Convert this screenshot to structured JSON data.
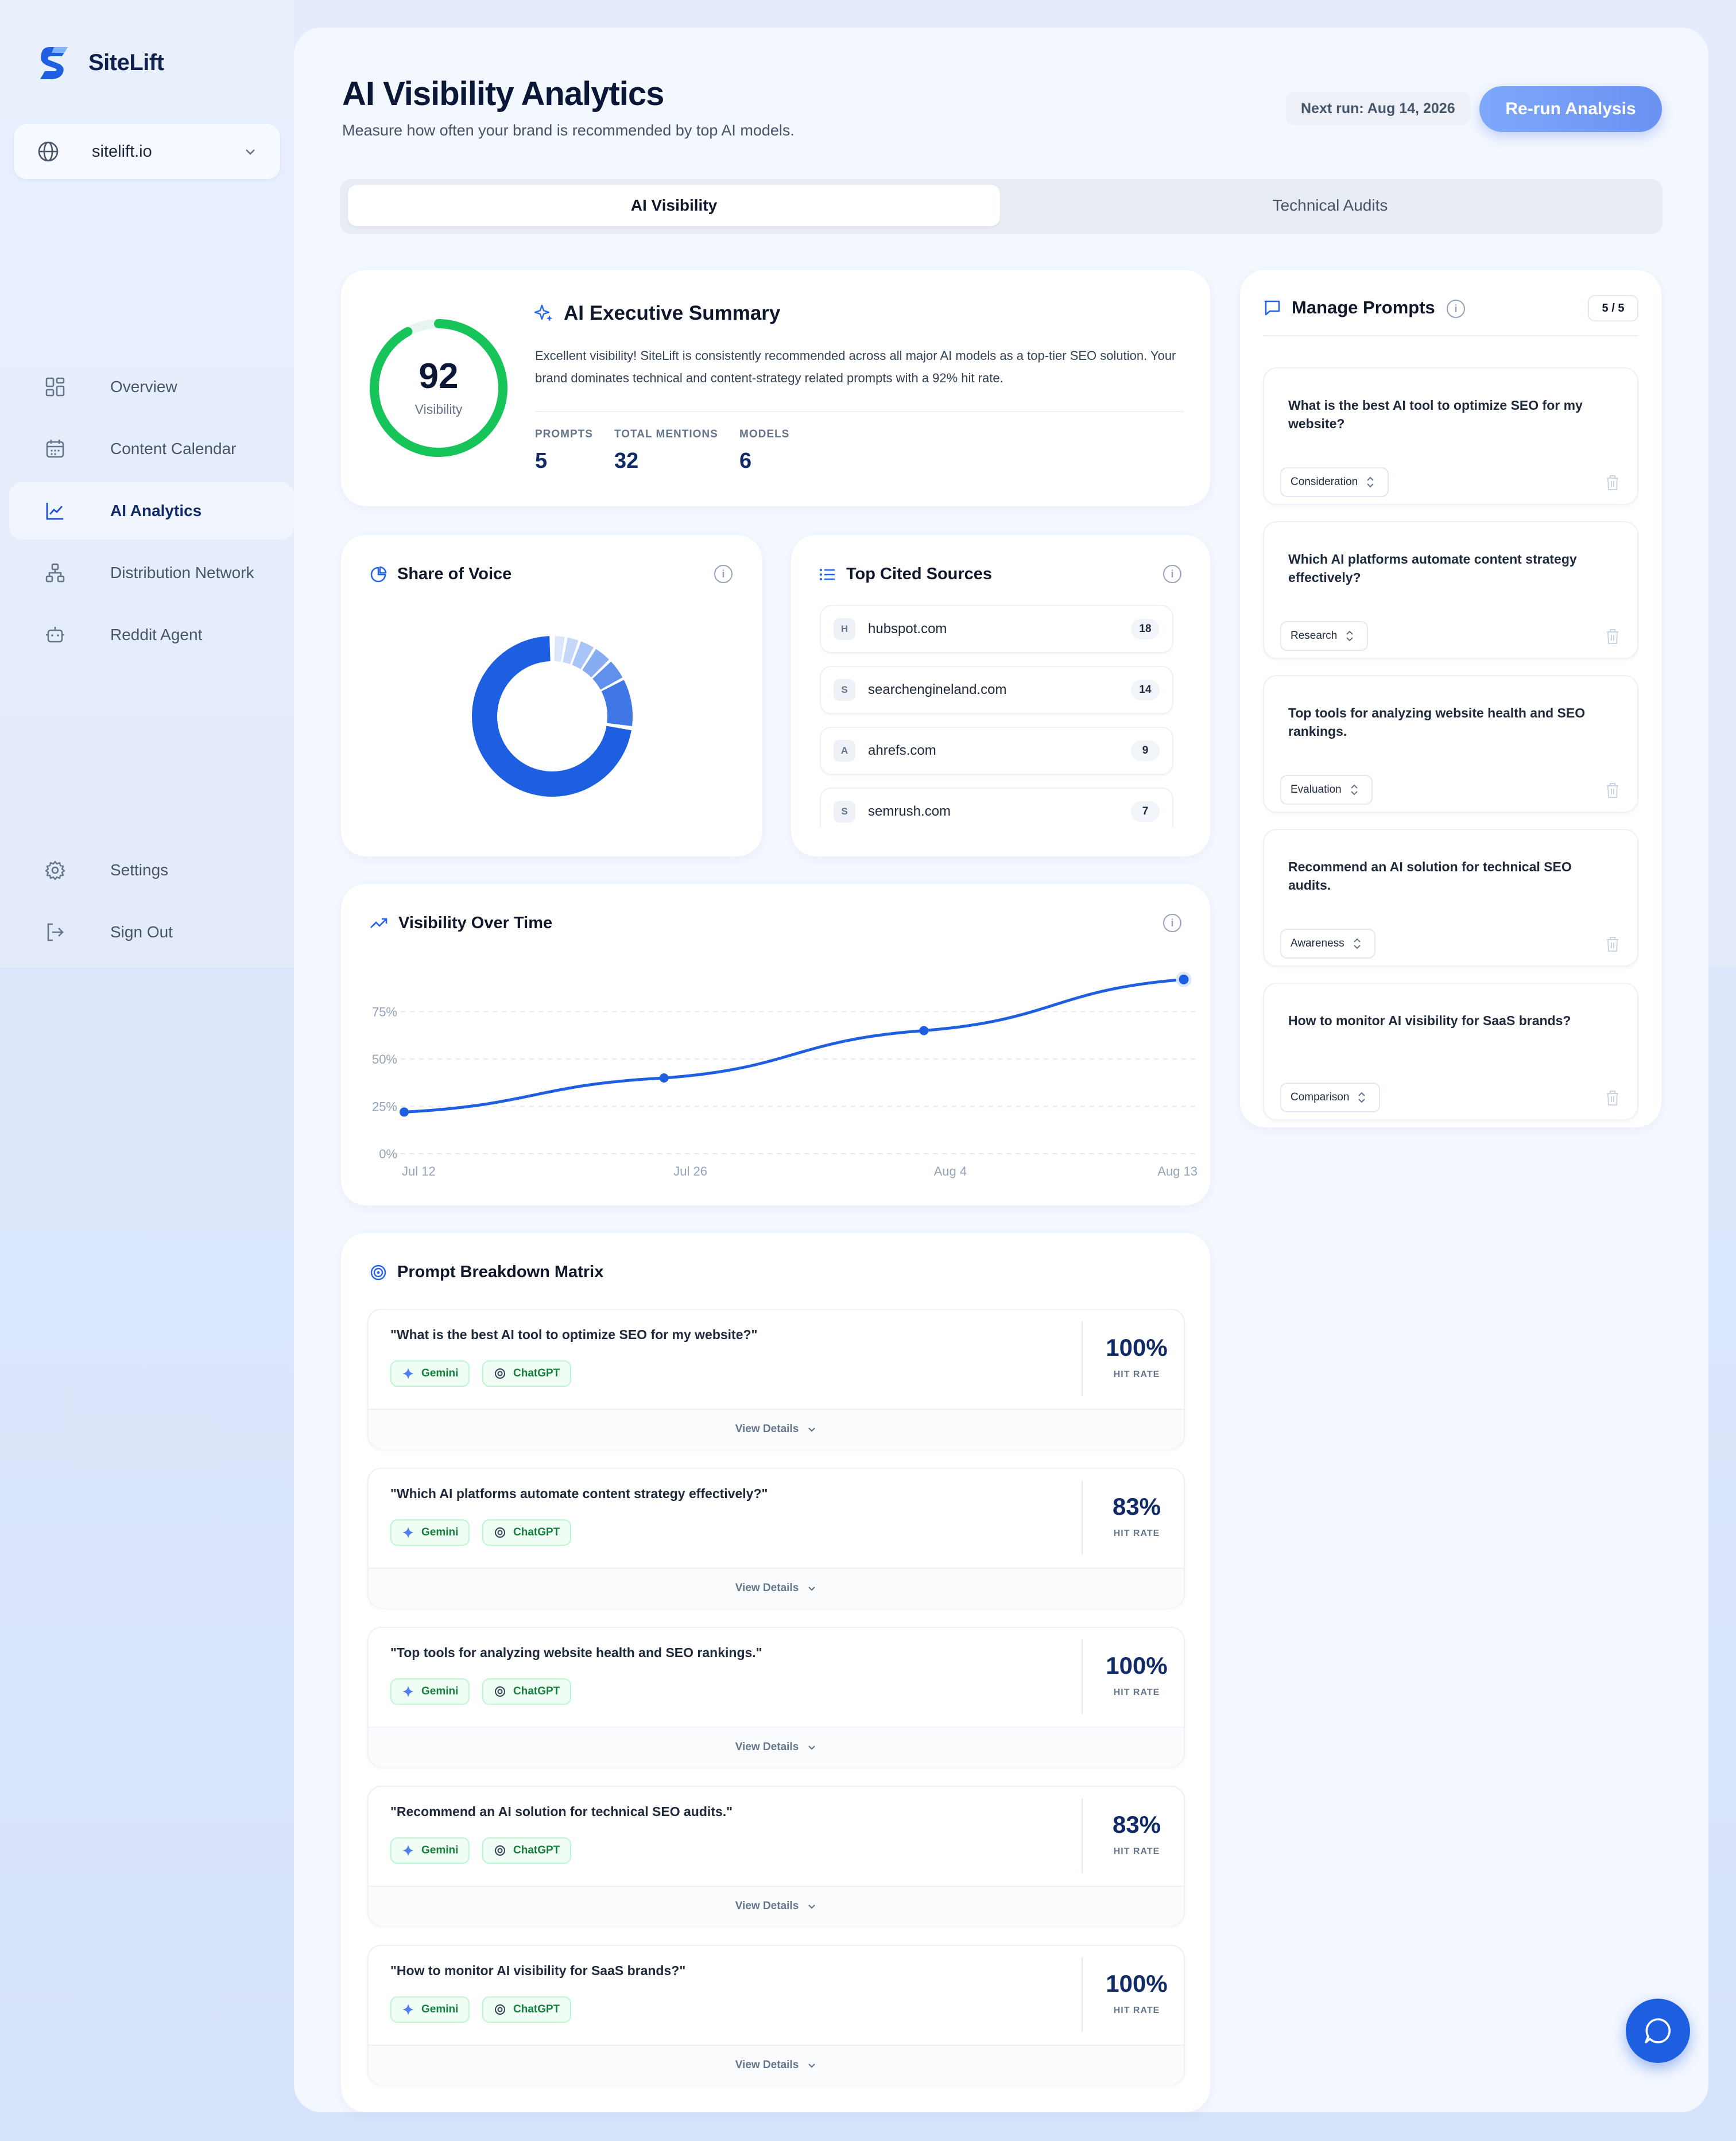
{
  "app": {
    "name": "SiteLift"
  },
  "site_selector": {
    "value": "sitelift.io"
  },
  "nav": {
    "overview": "Overview",
    "content_calendar": "Content Calendar",
    "ai_analytics": "AI Analytics",
    "distribution_network": "Distribution Network",
    "reddit_agent": "Reddit Agent",
    "settings": "Settings",
    "sign_out": "Sign Out"
  },
  "header": {
    "title": "AI Visibility Analytics",
    "subtitle": "Measure how often your brand is recommended by top AI models.",
    "next_run": "Next run: Aug 14, 2026",
    "rerun_label": "Re-run Analysis"
  },
  "tabs": {
    "ai_visibility": "AI Visibility",
    "technical_audits": "Technical Audits"
  },
  "summary": {
    "score": "92",
    "score_label": "Visibility",
    "score_fraction": 0.92,
    "title": "AI Executive Summary",
    "text": "Excellent visibility! SiteLift is consistently recommended across all major AI models as a top-tier SEO solution. Your brand dominates technical and content-strategy related prompts with a 92% hit rate.",
    "stats": [
      {
        "label": "PROMPTS",
        "value": "5"
      },
      {
        "label": "TOTAL MENTIONS",
        "value": "32"
      },
      {
        "label": "MODELS",
        "value": "6"
      }
    ]
  },
  "share_of_voice": {
    "title": "Share of Voice"
  },
  "top_sources": {
    "title": "Top Cited Sources",
    "items": [
      {
        "letter": "H",
        "domain": "hubspot.com",
        "count": "18"
      },
      {
        "letter": "S",
        "domain": "searchengineland.com",
        "count": "14"
      },
      {
        "letter": "A",
        "domain": "ahrefs.com",
        "count": "9"
      },
      {
        "letter": "S",
        "domain": "semrush.com",
        "count": "7"
      }
    ]
  },
  "chart_data": {
    "type": "line",
    "title": "Visibility Over Time",
    "x": [
      "Jul 12",
      "Jul 26",
      "Aug 4",
      "Aug 13"
    ],
    "y_ticks": [
      "0%",
      "25%",
      "50%",
      "75%"
    ],
    "ylim": [
      0,
      100
    ],
    "series": [
      {
        "values": [
          22,
          40,
          65,
          92
        ]
      }
    ],
    "grid": true,
    "color": "#1d5fe0"
  },
  "prompts": {
    "title": "Manage Prompts",
    "count": "5 / 5",
    "items": [
      {
        "text": "What is the best AI tool to optimize SEO for my website?",
        "stage": "Consideration"
      },
      {
        "text": "Which AI platforms automate content strategy effectively?",
        "stage": "Research"
      },
      {
        "text": "Top tools for analyzing website health and SEO rankings.",
        "stage": "Evaluation"
      },
      {
        "text": "Recommend an AI solution for technical SEO audits.",
        "stage": "Awareness"
      },
      {
        "text": "How to monitor AI visibility for SaaS brands?",
        "stage": "Comparison"
      }
    ]
  },
  "breakdown": {
    "title": "Prompt Breakdown Matrix",
    "hit_rate_label": "HIT RATE",
    "details_label": "View Details",
    "model_a": "Gemini",
    "model_b": "ChatGPT",
    "rows": [
      {
        "prompt": "\"What is the best AI tool to optimize SEO for my website?\"",
        "rate": "100%"
      },
      {
        "prompt": "\"Which AI platforms automate content strategy effectively?\"",
        "rate": "83%"
      },
      {
        "prompt": "\"Top tools for analyzing website health and SEO rankings.\"",
        "rate": "100%"
      },
      {
        "prompt": "\"Recommend an AI solution for technical SEO audits.\"",
        "rate": "83%"
      },
      {
        "prompt": "\"How to monitor AI visibility for SaaS brands?\"",
        "rate": "100%"
      }
    ]
  },
  "colors": {
    "accent": "#1d5fe0",
    "score_ring": "#16c45a",
    "chip_green": "#15803d"
  }
}
